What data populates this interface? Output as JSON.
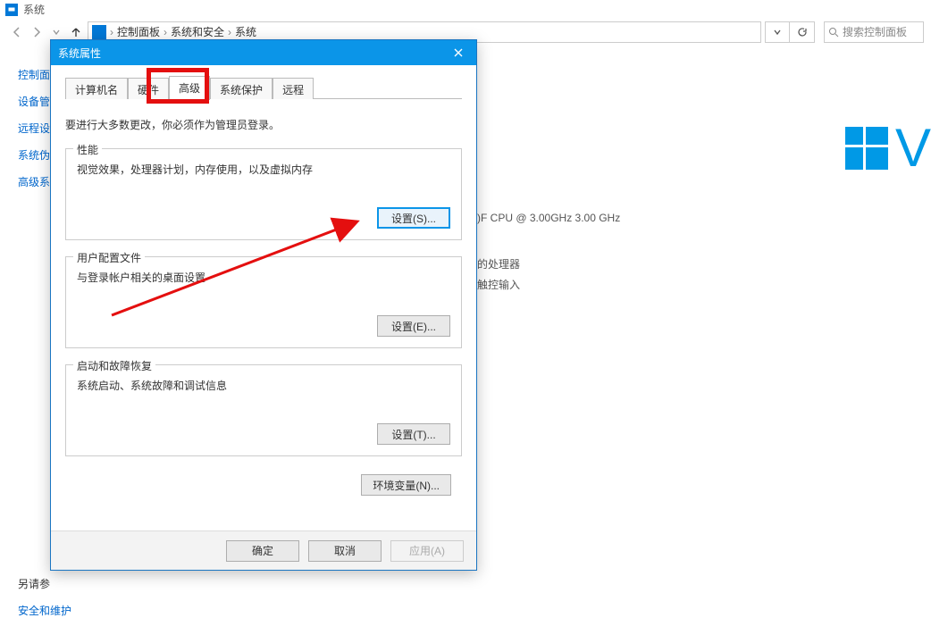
{
  "window": {
    "title": "系统"
  },
  "breadcrumb": {
    "items": [
      "控制面板",
      "系统和安全",
      "系统"
    ]
  },
  "search": {
    "placeholder": "搜索控制面板"
  },
  "sidebar": {
    "links": [
      "控制面",
      "设备管",
      "远程设",
      "系统伪",
      "高级系"
    ],
    "footer_hint": "另请参",
    "footer_link": "安全和维护"
  },
  "fragments": {
    "cpu": ")F CPU @ 3.00GHz   3.00 GHz",
    "proc": "的处理器",
    "touch": "触控输入"
  },
  "oslogo": {
    "letter": "V"
  },
  "dialog": {
    "title": "系统属性",
    "tabs": [
      "计算机名",
      "硬件",
      "高级",
      "系统保护",
      "远程"
    ],
    "active_tab_index": 2,
    "admin_note": "要进行大多数更改，你必须作为管理员登录。",
    "groups": [
      {
        "legend": "性能",
        "desc": "视觉效果，处理器计划，内存使用，以及虚拟内存",
        "button": "设置(S)...",
        "button_highlight": true
      },
      {
        "legend": "用户配置文件",
        "desc": "与登录帐户相关的桌面设置",
        "button": "设置(E)...",
        "button_highlight": false
      },
      {
        "legend": "启动和故障恢复",
        "desc": "系统启动、系统故障和调试信息",
        "button": "设置(T)...",
        "button_highlight": false
      }
    ],
    "env_button": "环境变量(N)...",
    "footer": {
      "ok": "确定",
      "cancel": "取消",
      "apply": "应用(A)"
    }
  }
}
